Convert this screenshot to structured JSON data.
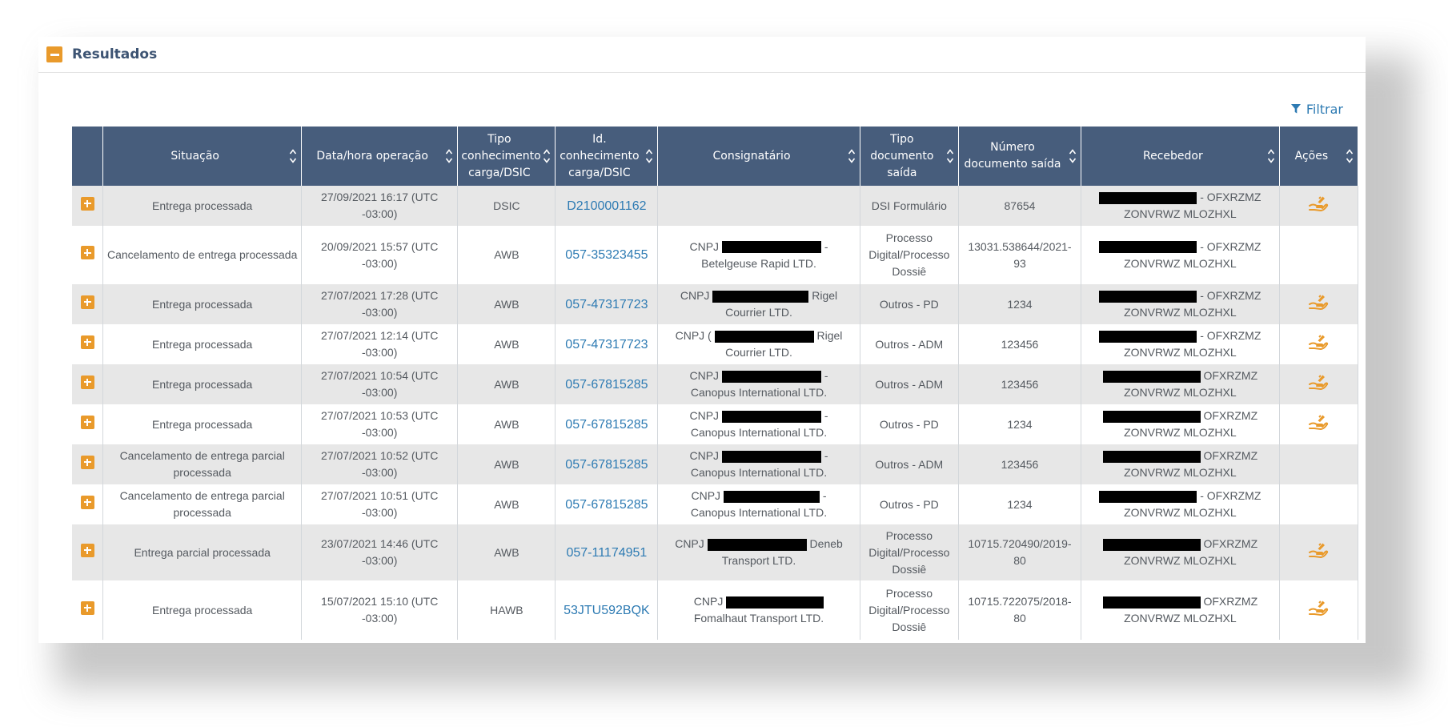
{
  "panel": {
    "title": "Resultados"
  },
  "filter": {
    "label": "Filtrar"
  },
  "columns": [
    "",
    "Situação",
    "Data/hora operação",
    "Tipo conhecimento carga/DSIC",
    "Id. conhecimento carga/DSIC",
    "Consignatário",
    "Tipo documento saída",
    "Número documento saída",
    "Recebedor",
    "Ações"
  ],
  "rows": [
    {
      "situacao": "Entrega processada",
      "data": "27/09/2021 16:17 (UTC -03:00)",
      "tipo": "DSIC",
      "id": "D2100001162",
      "consig_pre": "",
      "consig_post": "",
      "consig_line2": "",
      "tipo_doc": "DSI Formulário",
      "numero": "87654",
      "receb_post": "- OFXRZMZ",
      "receb_line2": "ZONVRWZ MLOZHXL",
      "acao": true
    },
    {
      "situacao": "Cancelamento de entrega processada",
      "data": "20/09/2021 15:57 (UTC -03:00)",
      "tipo": "AWB",
      "id": "057-35323455",
      "consig_pre": "CNPJ",
      "consig_post": "-",
      "consig_line2": "Betelgeuse Rapid LTD.",
      "tipo_doc": "Processo Digital/Processo Dossiê",
      "numero": "13031.538644/2021-93",
      "receb_post": "- OFXRZMZ",
      "receb_line2": "ZONVRWZ MLOZHXL",
      "acao": false
    },
    {
      "situacao": "Entrega processada",
      "data": "27/07/2021 17:28 (UTC -03:00)",
      "tipo": "AWB",
      "id": "057-47317723",
      "consig_pre": "CNPJ",
      "consig_post": "Rigel",
      "consig_line2": "Courrier LTD.",
      "tipo_doc": "Outros - PD",
      "numero": "1234",
      "receb_post": "- OFXRZMZ",
      "receb_line2": "ZONVRWZ MLOZHXL",
      "acao": true
    },
    {
      "situacao": "Entrega processada",
      "data": "27/07/2021 12:14 (UTC -03:00)",
      "tipo": "AWB",
      "id": "057-47317723",
      "consig_pre": "CNPJ (",
      "consig_post": "Rigel",
      "consig_line2": "Courrier LTD.",
      "tipo_doc": "Outros - ADM",
      "numero": "123456",
      "receb_post": "- OFXRZMZ",
      "receb_line2": "ZONVRWZ MLOZHXL",
      "acao": true
    },
    {
      "situacao": "Entrega processada",
      "data": "27/07/2021 10:54 (UTC -03:00)",
      "tipo": "AWB",
      "id": "057-67815285",
      "consig_pre": "CNPJ",
      "consig_post": "-",
      "consig_line2": "Canopus International LTD.",
      "tipo_doc": "Outros - ADM",
      "numero": "123456",
      "receb_post": "OFXRZMZ",
      "receb_line2": "ZONVRWZ MLOZHXL",
      "acao": true
    },
    {
      "situacao": "Entrega processada",
      "data": "27/07/2021 10:53 (UTC -03:00)",
      "tipo": "AWB",
      "id": "057-67815285",
      "consig_pre": "CNPJ",
      "consig_post": "-",
      "consig_line2": "Canopus International LTD.",
      "tipo_doc": "Outros - PD",
      "numero": "1234",
      "receb_post": "OFXRZMZ",
      "receb_line2": "ZONVRWZ MLOZHXL",
      "acao": true
    },
    {
      "situacao": "Cancelamento de entrega parcial processada",
      "data": "27/07/2021 10:52 (UTC -03:00)",
      "tipo": "AWB",
      "id": "057-67815285",
      "consig_pre": "CNPJ",
      "consig_post": "-",
      "consig_line2": "Canopus International LTD.",
      "tipo_doc": "Outros - ADM",
      "numero": "123456",
      "receb_post": "OFXRZMZ",
      "receb_line2": "ZONVRWZ MLOZHXL",
      "acao": false
    },
    {
      "situacao": "Cancelamento de entrega parcial processada",
      "data": "27/07/2021 10:51 (UTC -03:00)",
      "tipo": "AWB",
      "id": "057-67815285",
      "consig_pre": "CNPJ",
      "consig_post": "-",
      "consig_line2": "Canopus International LTD.",
      "tipo_doc": "Outros - PD",
      "numero": "1234",
      "receb_post": "- OFXRZMZ",
      "receb_line2": "ZONVRWZ MLOZHXL",
      "acao": false
    },
    {
      "situacao": "Entrega parcial processada",
      "data": "23/07/2021 14:46 (UTC -03:00)",
      "tipo": "AWB",
      "id": "057-11174951",
      "consig_pre": "CNPJ",
      "consig_post": "Deneb",
      "consig_line2": "Transport LTD.",
      "tipo_doc": "Processo Digital/Processo Dossiê",
      "numero": "10715.720490/2019-80",
      "receb_post": "OFXRZMZ",
      "receb_line2": "ZONVRWZ MLOZHXL",
      "acao": true
    },
    {
      "situacao": "Entrega processada",
      "data": "15/07/2021 15:10 (UTC -03:00)",
      "tipo": "HAWB",
      "id": "53JTU592BQK",
      "consig_pre": "CNPJ",
      "consig_post": "",
      "consig_line2": "Fomalhaut Transport LTD.",
      "tipo_doc": "Processo Digital/Processo Dossiê",
      "numero": "10715.722075/2018-80",
      "receb_post": "OFXRZMZ",
      "receb_line2": "ZONVRWZ MLOZHXL",
      "acao": true
    }
  ],
  "colors": {
    "header_bg": "#475d7c",
    "accent": "#e99a2b",
    "link": "#2e7bb3",
    "row_alt": "#e7e7e7"
  },
  "icons": {
    "collapse": "minus-square-icon",
    "filter": "filter-funnel-icon",
    "expand": "plus-square-icon",
    "sort": "sort-arrows-icon",
    "action": "hand-delivery-icon"
  }
}
